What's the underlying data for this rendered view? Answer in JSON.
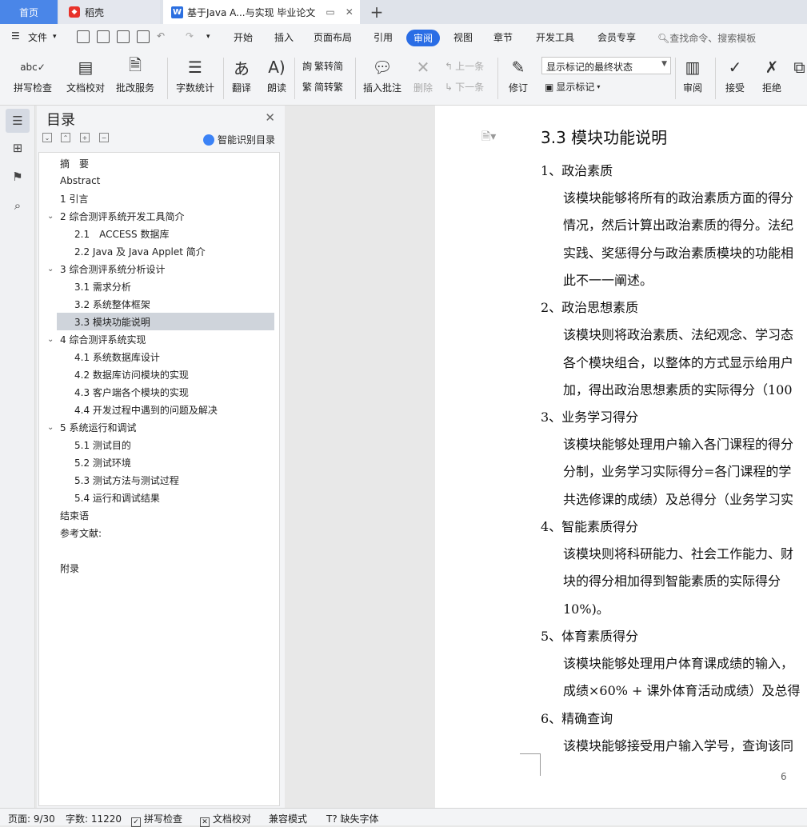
{
  "tabs": {
    "home": "首页",
    "daoke": "稻壳",
    "doc": "基于Java A...与实现 毕业论文"
  },
  "menu": {
    "file": "文件",
    "items": [
      "开始",
      "插入",
      "页面布局",
      "引用",
      "审阅",
      "视图",
      "章节",
      "开发工具",
      "会员专享"
    ],
    "active": "审阅",
    "search": "查找命令、搜索模板"
  },
  "ribbon": {
    "spell": "拼写检查",
    "proofread": "文档校对",
    "review_service": "批改服务",
    "word_count": "字数统计",
    "translate": "翻译",
    "read_aloud": "朗读",
    "trad_to_simp": "繁转简",
    "simp_to_trad": "简转繁",
    "insert_comment": "插入批注",
    "delete": "删除",
    "prev": "上一条",
    "next": "下一条",
    "revise": "修订",
    "markup_combo": "显示标记的最终状态",
    "show_markup": "显示标记",
    "review": "审阅",
    "accept": "接受",
    "reject": "拒绝"
  },
  "toc": {
    "title": "目录",
    "smart": "智能识别目录",
    "items": [
      {
        "label": "摘　要",
        "level": 1
      },
      {
        "label": "Abstract",
        "level": 1
      },
      {
        "label": "1  引言",
        "level": 1
      },
      {
        "label": "2  综合测评系统开发工具简介",
        "level": 1,
        "expandable": true
      },
      {
        "label": "2.1　ACCESS 数据库",
        "level": 2
      },
      {
        "label": "2.2 Java 及 Java Applet 简介",
        "level": 2
      },
      {
        "label": "3  综合测评系统分析设计",
        "level": 1,
        "expandable": true
      },
      {
        "label": "3.1 需求分析",
        "level": 2
      },
      {
        "label": "3.2 系统整体框架",
        "level": 2
      },
      {
        "label": "3.3 模块功能说明",
        "level": 2,
        "selected": true
      },
      {
        "label": "4  综合测评系统实现",
        "level": 1,
        "expandable": true
      },
      {
        "label": "4.1 系统数据库设计",
        "level": 2
      },
      {
        "label": "4.2 数据库访问模块的实现",
        "level": 2
      },
      {
        "label": "4.3 客户端各个模块的实现",
        "level": 2
      },
      {
        "label": "4.4 开发过程中遇到的问题及解决",
        "level": 2
      },
      {
        "label": "5  系统运行和调试",
        "level": 1,
        "expandable": true
      },
      {
        "label": "5.1 测试目的",
        "level": 2
      },
      {
        "label": "5.2 测试环境",
        "level": 2
      },
      {
        "label": "5.3 测试方法与测试过程",
        "level": 2
      },
      {
        "label": "5.4 运行和调试结果",
        "level": 2
      },
      {
        "label": "结束语",
        "level": 1
      },
      {
        "label": "参考文献:",
        "level": 1
      },
      {
        "label": "附录",
        "level": 1
      }
    ]
  },
  "document": {
    "heading": "3.3 模块功能说明",
    "sections": [
      {
        "head": "1、政治素质",
        "lines": [
          "该模块能够将所有的政治素质方面的得分",
          "情况，然后计算出政治素质的得分。法纪",
          "实践、奖惩得分与政治素质模块的功能相",
          "此不一一阐述。"
        ]
      },
      {
        "head": "2、政治思想素质",
        "lines": [
          "该模块则将政治素质、法纪观念、学习态",
          "各个模块组合，以整体的方式显示给用户",
          "加，得出政治思想素质的实际得分（100"
        ]
      },
      {
        "head": "3、业务学习得分",
        "lines": [
          "该模块能够处理用户输入各门课程的得分",
          "分制，业务学习实际得分=各门课程的学",
          "共选修课的成绩）及总得分（业务学习实"
        ]
      },
      {
        "head": "4、智能素质得分",
        "lines": [
          "该模块则将科研能力、社会工作能力、财",
          "块的得分相加得到智能素质的实际得分",
          "10%)。"
        ]
      },
      {
        "head": "5、体育素质得分",
        "lines": [
          "该模块能够处理用户体育课成绩的输入，",
          "成绩×60% + 课外体育活动成绩）及总得"
        ]
      },
      {
        "head": "6、精确查询",
        "lines": [
          "该模块能够接受用户输入学号，查询该同"
        ]
      }
    ],
    "page_number": "6"
  },
  "status": {
    "page": "页面: 9/30",
    "words": "字数: 11220",
    "spell": "拼写检查",
    "proof": "文档校对",
    "compat": "兼容模式",
    "missing_font": "缺失字体"
  }
}
